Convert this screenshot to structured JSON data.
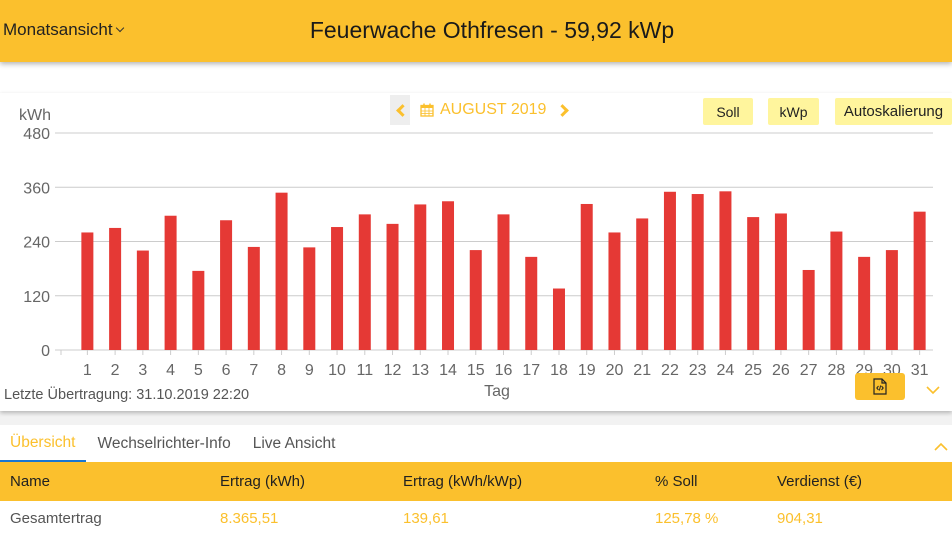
{
  "header": {
    "view_select": "Monatsansicht",
    "title": "Feuerwache Othfresen - 59,92 kWp"
  },
  "nav": {
    "month": "AUGUST 2019",
    "prev_icon": "chevron-left-icon",
    "next_icon": "chevron-right-icon",
    "calendar_icon": "calendar-icon"
  },
  "toggles": {
    "soll": "Soll",
    "kwp": "kWp",
    "autoscale": "Autoskalierung"
  },
  "status": {
    "last_transfer": "Letzte Übertragung: 31.10.2019 22:20"
  },
  "colors": {
    "brand": "#fbc02d",
    "bar": "#e53935",
    "chip": "#fff59d",
    "tab_indicator": "#1976d2"
  },
  "chart_data": {
    "type": "bar",
    "title": "",
    "xlabel": "Tag",
    "ylabel": "kWh",
    "ylim": [
      0,
      480
    ],
    "yticks": [
      0,
      120,
      240,
      360,
      480
    ],
    "grid": true,
    "categories": [
      "1",
      "2",
      "3",
      "4",
      "5",
      "6",
      "7",
      "8",
      "9",
      "10",
      "11",
      "12",
      "13",
      "14",
      "15",
      "16",
      "17",
      "18",
      "19",
      "20",
      "21",
      "22",
      "23",
      "24",
      "25",
      "26",
      "27",
      "28",
      "29",
      "30",
      "31"
    ],
    "values": [
      260,
      270,
      220,
      297,
      175,
      287,
      228,
      348,
      227,
      272,
      300,
      279,
      322,
      329,
      221,
      300,
      206,
      136,
      323,
      260,
      291,
      350,
      345,
      351,
      294,
      302,
      177,
      262,
      206,
      221,
      306
    ]
  },
  "tabs": [
    {
      "label": "Übersicht",
      "active": true
    },
    {
      "label": "Wechselrichter-Info",
      "active": false
    },
    {
      "label": "Live Ansicht",
      "active": false
    }
  ],
  "table": {
    "headers": [
      "Name",
      "Ertrag (kWh)",
      "Ertrag (kWh/kWp)",
      "% Soll",
      "Verdienst (€)"
    ],
    "rows": [
      [
        "Gesamtertrag",
        "8.365,51",
        "139,61",
        "125,78 %",
        "904,31"
      ]
    ]
  }
}
